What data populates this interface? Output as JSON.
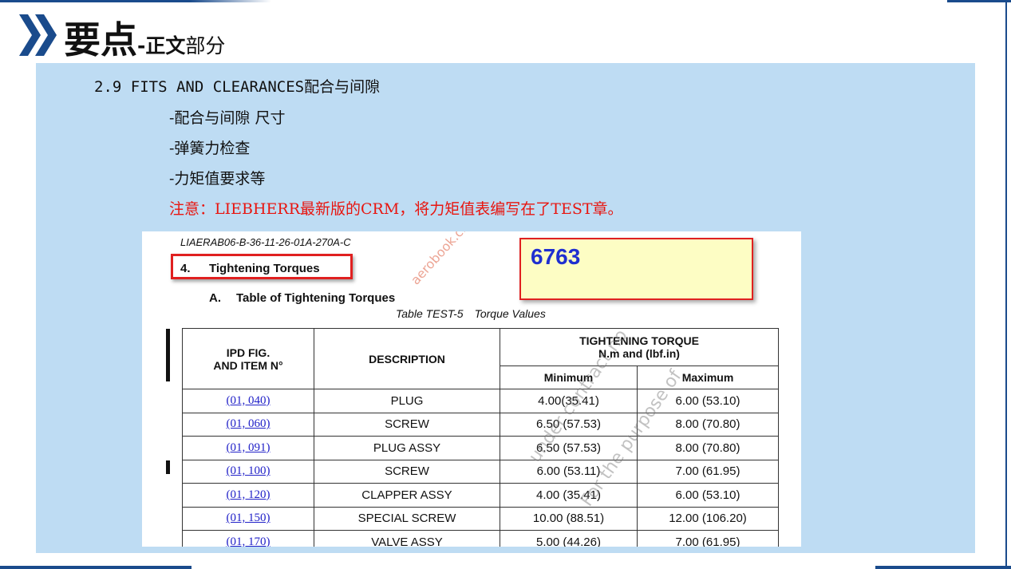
{
  "header": {
    "title_main": "要点",
    "title_sub_dash": "-正文",
    "title_sub_rest": "部分"
  },
  "content": {
    "heading_latin": "2.9 FITS AND CLEARANCES",
    "heading_cjk": "配合与间隙",
    "items": [
      "-配合与间隙 尺寸",
      "-弹簧力检查",
      "-力矩值要求等"
    ],
    "note": "注意：LIEBHERR最新版的CRM，将力矩值表编写在了TEST章。"
  },
  "document": {
    "reference": "LIAERAB06-B-36-11-26-01A-270A-C",
    "section_number": "4.",
    "section_title": "Tightening Torques",
    "subsection_letter": "A.",
    "subsection_title": "Table of Tightening Torques",
    "caption_label": "Table TEST-5",
    "caption_title": "Torque Values",
    "note_value": "6763",
    "table": {
      "headers": {
        "ipd_line1": "IPD FIG.",
        "ipd_line2": "AND ITEM N°",
        "description": "DESCRIPTION",
        "torque_line1": "TIGHTENING TORQUE",
        "torque_line2": "N.m and (lbf.in)",
        "minimum": "Minimum",
        "maximum": "Maximum"
      },
      "rows": [
        {
          "item": "(01, 040)",
          "description": "PLUG",
          "min": "4.00(35.41)",
          "max": "6.00 (53.10)"
        },
        {
          "item": "(01, 060)",
          "description": "SCREW",
          "min": "6.50 (57.53)",
          "max": "8.00 (70.80)"
        },
        {
          "item": "(01, 091)",
          "description": "PLUG ASSY",
          "min": "6.50 (57.53)",
          "max": "8.00 (70.80)"
        },
        {
          "item": "(01, 100)",
          "description": "SCREW",
          "min": "6.00 (53.11)",
          "max": "7.00 (61.95)"
        },
        {
          "item": "(01, 120)",
          "description": "CLAPPER ASSY",
          "min": "4.00 (35.41)",
          "max": "6.00 (53.10)"
        },
        {
          "item": "(01, 150)",
          "description": "SPECIAL SCREW",
          "min": "10.00 (88.51)",
          "max": "12.00 (106.20)"
        },
        {
          "item": "(01, 170)",
          "description": "VALVE ASSY",
          "min": "5.00 (44.26)",
          "max": "7.00 (61.95)"
        }
      ]
    },
    "watermarks": [
      "aerobook.cn有错误请联系我",
      "under contract no",
      "For the purpose of"
    ]
  },
  "colors": {
    "accent_blue": "#1a4b8c",
    "panel_bg": "#bedcf3",
    "note_red": "#e8150f",
    "highlight_yellow": "#fdfdc4",
    "link_blue": "#2121c8"
  }
}
